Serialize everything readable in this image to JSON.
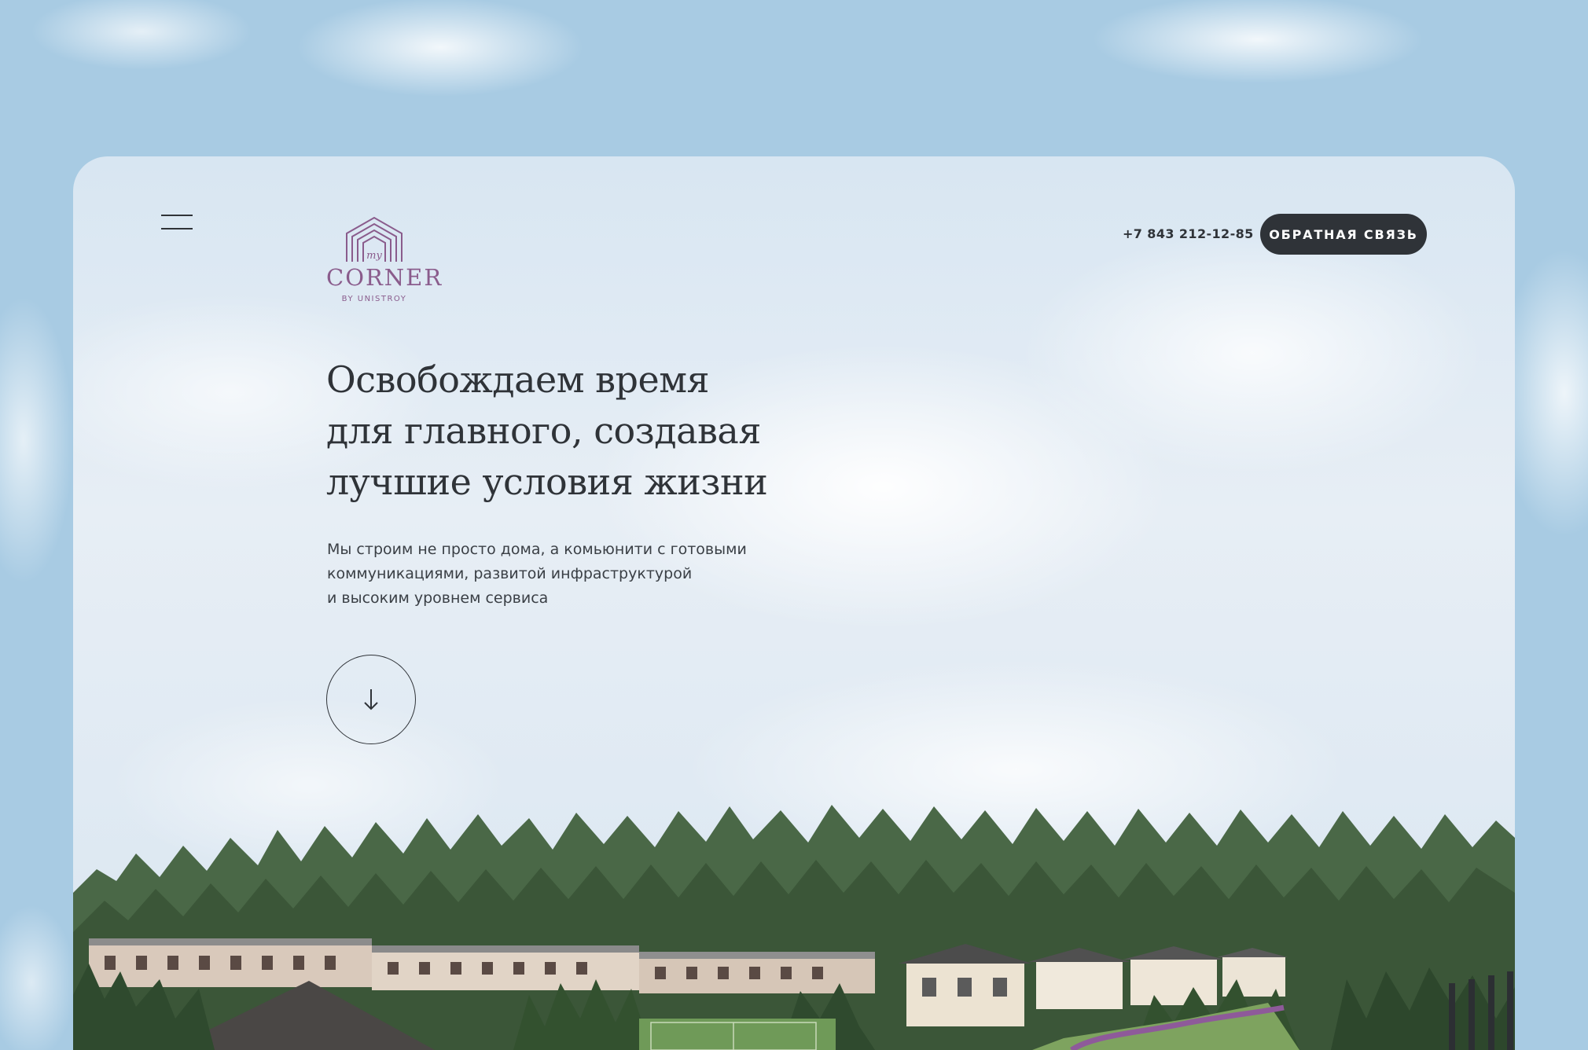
{
  "header": {
    "menu_icon": "hamburger-menu-icon",
    "logo": {
      "script": "my",
      "wordmark": "CORNER",
      "byline": "BY UNISTROY",
      "color": "#8a5c8c"
    },
    "phone": "+7 843 212-12-85",
    "cta_label": "ОБРАТНАЯ СВЯЗЬ"
  },
  "hero": {
    "headline_lines": [
      "Освобождаем время",
      "для главного, создавая",
      "лучшие условия жизни"
    ],
    "description_lines": [
      "Мы строим не просто дома, а комьюнити с готовыми",
      "коммуникациями, развитой инфраструктурой",
      "и высоким уровнем сервиса"
    ],
    "scroll_icon": "arrow-down-icon"
  },
  "colors": {
    "text_dark": "#2f3338",
    "button_bg": "#2f3338",
    "button_text": "#ffffff",
    "sky": "#a8cbe3",
    "card_bg": "#e3ecf4",
    "forest": "#3d5a3a",
    "path": "#8e5a9a"
  }
}
